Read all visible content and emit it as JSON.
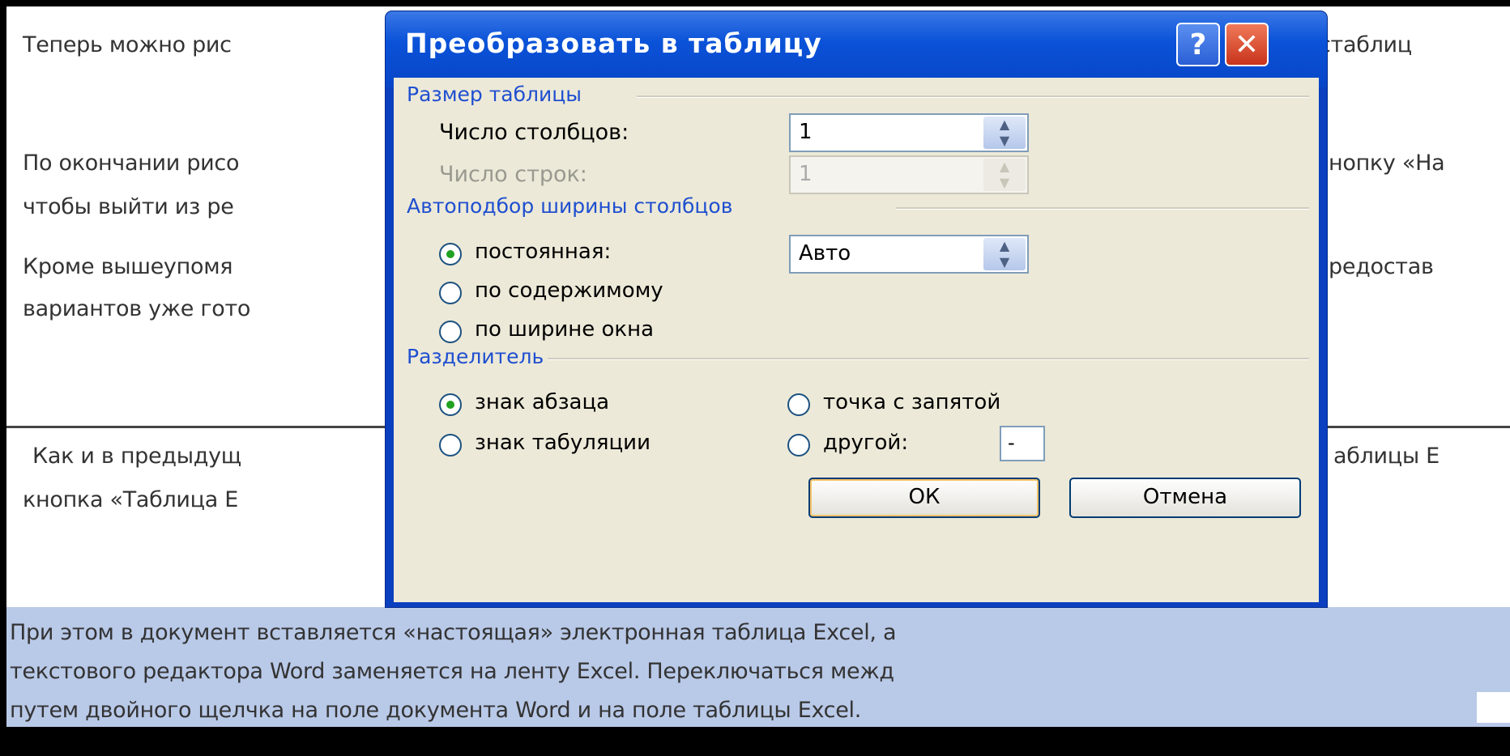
{
  "document": {
    "lines": [
      "Теперь можно рис",
      "кстаблиц",
      "По окончании рисо",
      "нопку «На",
      "чтобы выйти из ре",
      "Кроме вышеупомя",
      "редостав",
      "вариантов уже гото",
      "Как и в предыдущ",
      "аблицы E",
      "кнопка «Таблица E",
      "При этом в документ вставляется «настоящая» электронная  таблица Excel, а",
      "текстового редактора Word заменяется на ленту Excel. Переключаться межд",
      "путем двойного щелчка на поле документа Word и на поле таблицы Excel."
    ]
  },
  "dialog": {
    "title": "Преобразовать в таблицу",
    "help_glyph": "?",
    "close_glyph": "✕",
    "table_size": {
      "group_label": "Размер таблицы",
      "columns_label": "Число столбцов:",
      "columns_value": "1",
      "rows_label": "Число строк:",
      "rows_value": "1"
    },
    "autofit": {
      "group_label": "Автоподбор ширины столбцов",
      "fixed_label": "постоянная:",
      "fixed_value": "Авто",
      "content_label": "по содержимому",
      "window_label": "по ширине окна"
    },
    "separator": {
      "group_label": "Разделитель",
      "paragraph_label": "знак абзаца",
      "semicolon_label": "точка с запятой",
      "tab_label": "знак табуляции",
      "other_label": "другой:",
      "other_value": "-"
    },
    "ok_label": "ОК",
    "cancel_label": "Отмена"
  }
}
